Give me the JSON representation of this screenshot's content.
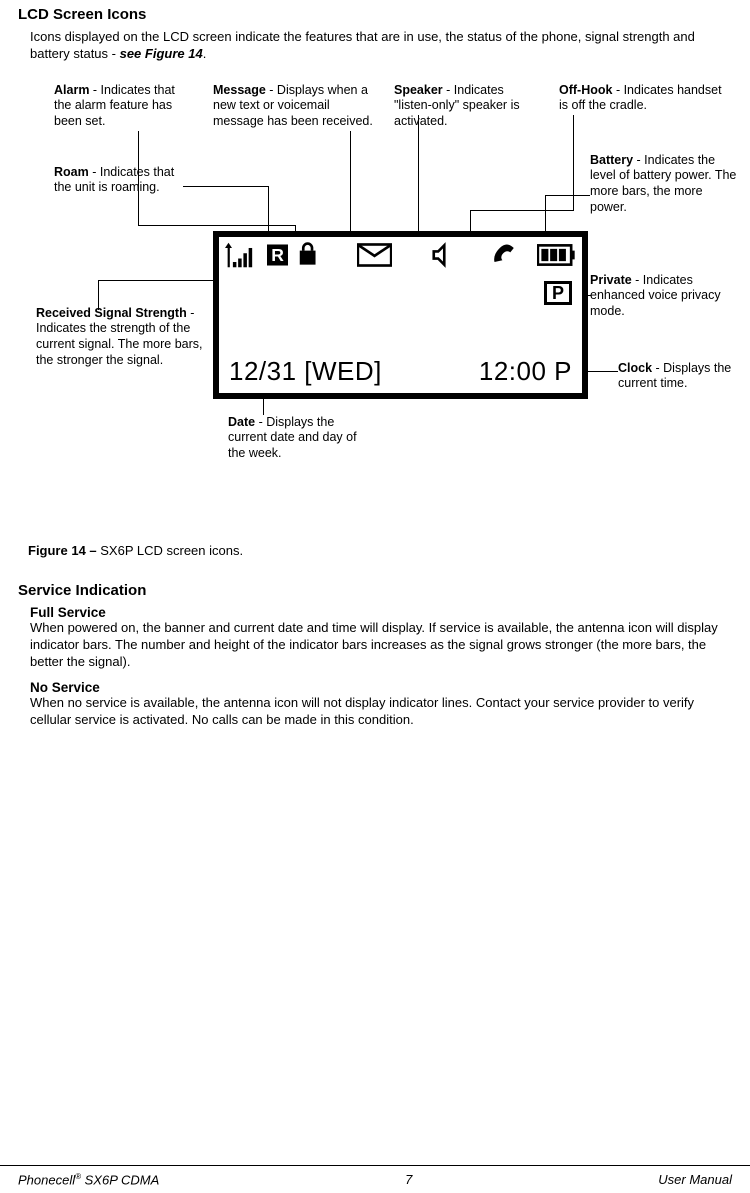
{
  "heading": "LCD Screen Icons",
  "intro_part1": "Icons displayed on the LCD screen indicate the features that are in use, the status of the phone, signal strength and battery status - ",
  "intro_bold": "see Figure 14",
  "intro_part2": ".",
  "callouts": {
    "alarm": {
      "title": "Alarm",
      "text": " - Indicates that the alarm feature has been set."
    },
    "message": {
      "title": "Message",
      "text": " - Displays when a new text or voicemail message has been received."
    },
    "speaker": {
      "title": "Speaker",
      "text": " - Indicates \"listen-only\" speaker is activated."
    },
    "offhook": {
      "title": "Off-Hook",
      "text": " - Indicates handset is off the cradle."
    },
    "roam": {
      "title": "Roam",
      "text": " - Indicates that the unit is roaming."
    },
    "battery": {
      "title": "Battery",
      "text": " - Indicates the level of battery power. The more bars, the more power."
    },
    "private": {
      "title": "Private",
      "text": " - Indicates enhanced voice privacy mode."
    },
    "signal": {
      "title": "Received Signal Strength",
      "text": " - Indicates the strength of the current signal. The more bars, the stronger the signal."
    },
    "clock": {
      "title": "Clock",
      "text": " - Displays the current time."
    },
    "date": {
      "title": "Date",
      "text": " - Displays the current date and day of the week."
    }
  },
  "lcd": {
    "date_text": "12/31  [WED]",
    "time_text": "12:00 P",
    "private_label": "P"
  },
  "figure_caption_bold": "Figure 14 – ",
  "figure_caption_rest": "SX6P LCD screen icons.",
  "service": {
    "heading": "Service Indication",
    "full": {
      "title": "Full Service",
      "body": "When powered on, the banner and current date and time will display. If service is available, the antenna icon will display indicator bars. The number and height of the indicator bars increases as the signal grows stronger (the more bars, the better the signal)."
    },
    "no": {
      "title": "No Service",
      "body": "When no service is available, the antenna icon will not display indicator lines. Contact your service provider to verify cellular service is activated. No calls can be made in this condition."
    }
  },
  "footer": {
    "left_brand": "Phonecell",
    "left_reg": "®",
    "left_model": " SX6P CDMA",
    "page_num": "7",
    "right": "User Manual"
  }
}
